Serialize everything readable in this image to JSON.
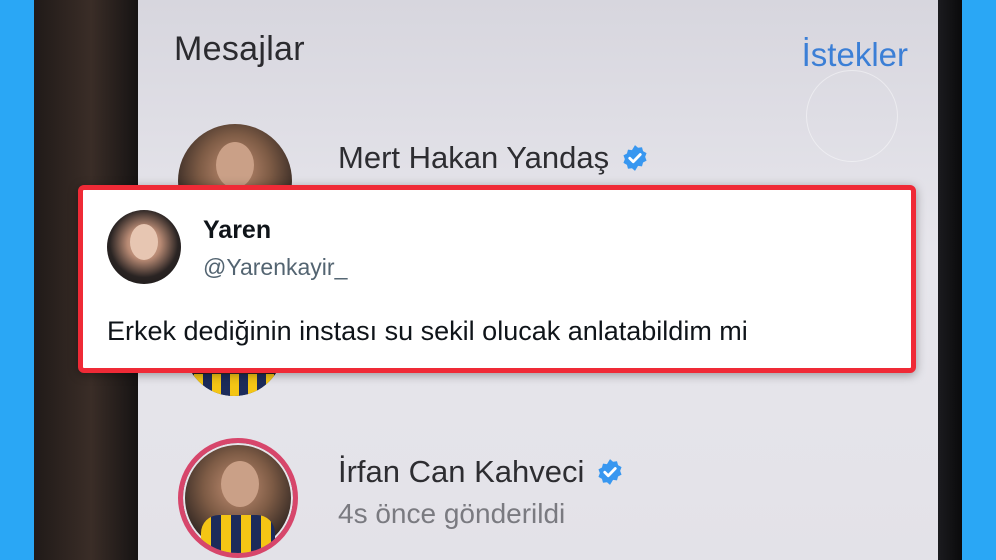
{
  "screen": {
    "title": "Mesajlar",
    "requests_label": "İstekler"
  },
  "messages": [
    {
      "name": "Mert Hakan Yandaş",
      "subtitle": "",
      "verified": true
    },
    {
      "name": "İrfan Can Kahveci",
      "subtitle": "4s önce gönderildi",
      "verified": true
    }
  ],
  "tweet": {
    "display_name": "Yaren",
    "handle": "@Yarenkayir_",
    "text": "Erkek dediğinin instası su sekil olucak anlatabildim mi"
  },
  "colors": {
    "background": "#2aa7f5",
    "card_border": "#ef2a36",
    "link_blue": "#3b7fd6",
    "verified_blue": "#3897f0"
  }
}
